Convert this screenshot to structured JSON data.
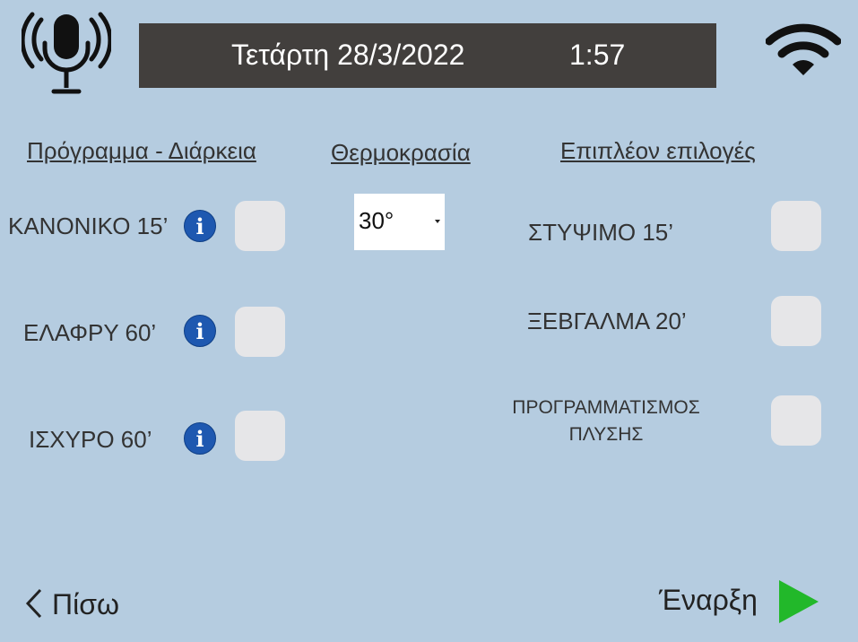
{
  "header": {
    "date": "Τετάρτη 28/3/2022",
    "time": "1:57",
    "mic_icon": "microphone-icon",
    "wifi_icon": "wifi-icon"
  },
  "columns": {
    "program_heading": "Πρόγραμμα - Διάρκεια",
    "temperature_heading": "Θερμοκρασία",
    "extra_heading": "Επιπλέον επιλογές"
  },
  "programs": [
    {
      "label": "ΚΑΝΟΝΙΚΟ 15’",
      "checked": false
    },
    {
      "label": "ΕΛΑΦΡΥ 60’",
      "checked": false
    },
    {
      "label": "ΙΣΧΥΡΟ 60’",
      "checked": false
    }
  ],
  "temperature": {
    "selected": "30°"
  },
  "extras": [
    {
      "label": "ΣΤΥΨΙΜΟ 15’",
      "checked": false
    },
    {
      "label": "ΞΕΒΓΑΛΜΑ 20’",
      "checked": false
    },
    {
      "label_line1": "ΠΡΟΓΡΑΜΜΑΤΙΣΜΟΣ",
      "label_line2": "ΠΛΥΣΗΣ",
      "checked": false
    }
  ],
  "footer": {
    "back_label": "Πίσω",
    "start_label": "Έναρξη"
  },
  "colors": {
    "background": "#b5cce0",
    "topbar": "#423f3d",
    "info": "#1e58b0",
    "play": "#22b82a"
  }
}
